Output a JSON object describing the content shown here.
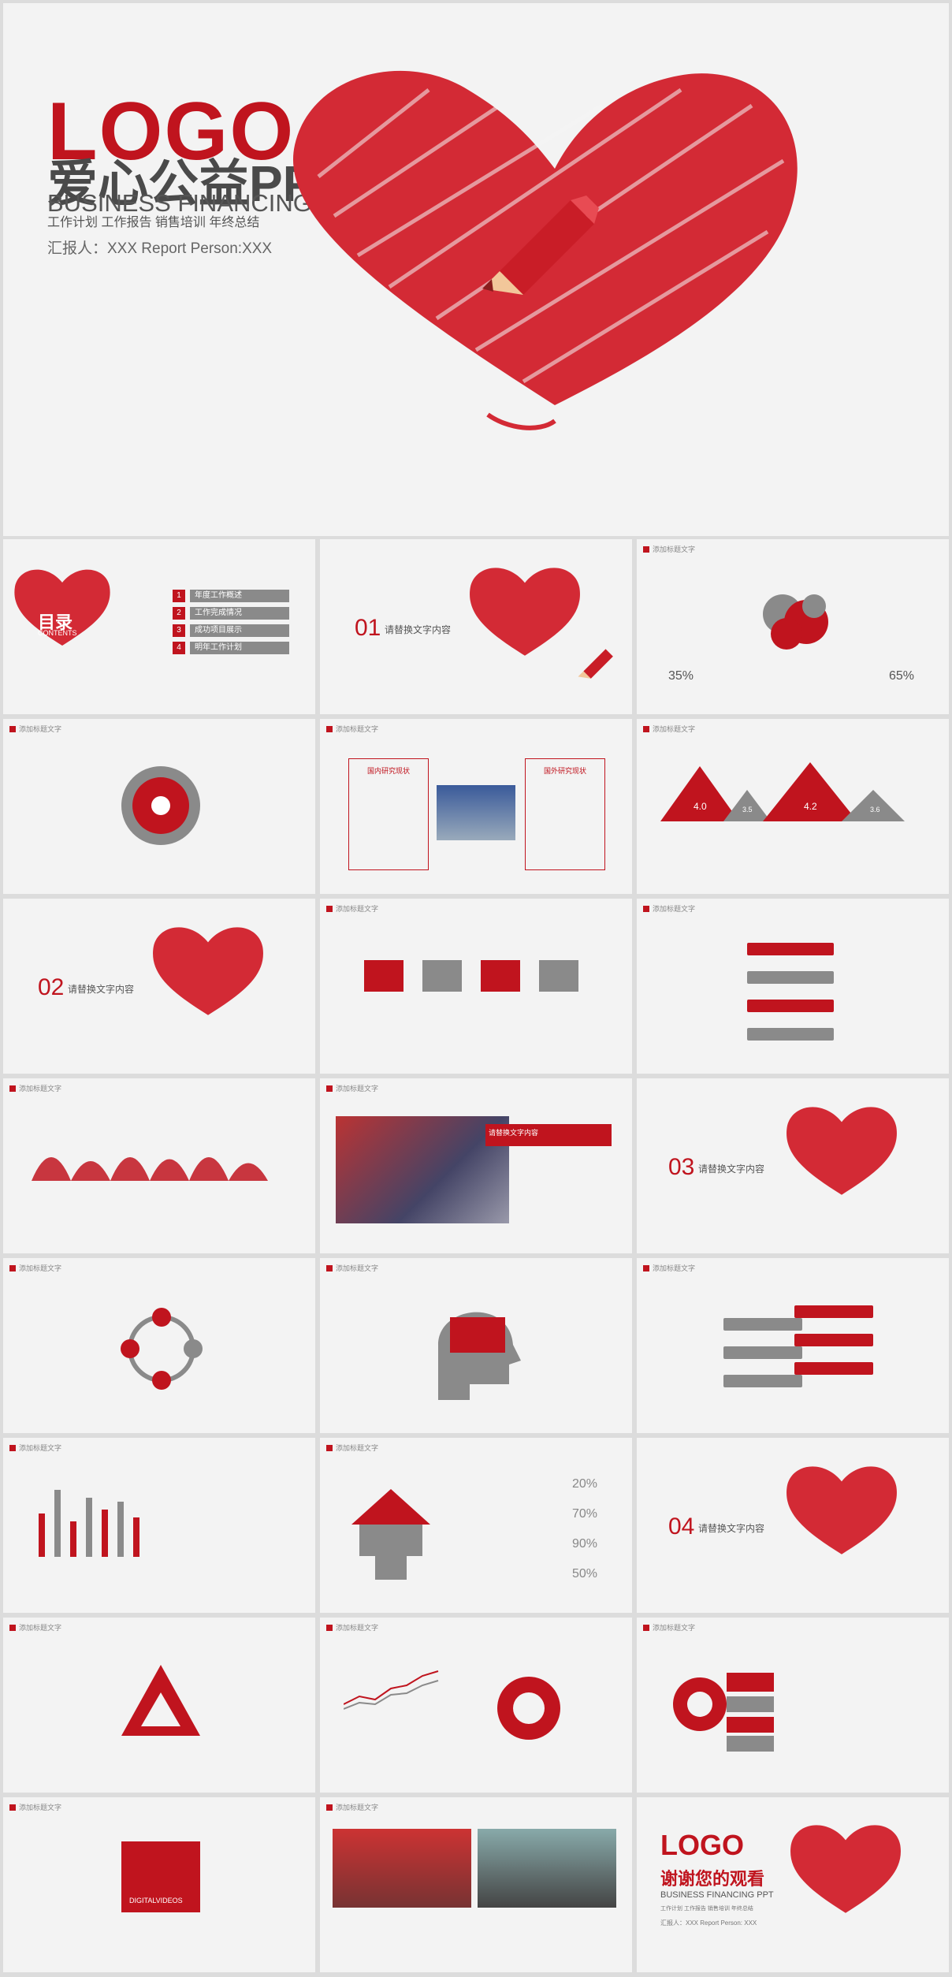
{
  "hero": {
    "logo": "LOGO",
    "title": "爱心公益PPT",
    "subtitle_en": "BUSINESS FINANCING PPT",
    "tags": "工作计划 工作报告 销售培训 年终总结",
    "reporter": "汇报人：XXX  Report Person:XXX"
  },
  "toc": {
    "title": "目录",
    "subtitle": "CONTENTS",
    "items": [
      {
        "num": "1",
        "label": "年度工作概述"
      },
      {
        "num": "2",
        "label": "工作完成情况"
      },
      {
        "num": "3",
        "label": "成功项目展示"
      },
      {
        "num": "4",
        "label": "明年工作计划"
      }
    ]
  },
  "sections": [
    {
      "num": "01",
      "label": "请替换文字内容"
    },
    {
      "num": "02",
      "label": "请替换文字内容"
    },
    {
      "num": "03",
      "label": "请替换文字内容"
    },
    {
      "num": "04",
      "label": "请替换文字内容"
    }
  ],
  "slide_tag": "添加标题文字",
  "percent_left": "35%",
  "percent_right": "65%",
  "box_left_title": "国内研究现状",
  "box_right_title": "国外研究现状",
  "mountain_values": [
    "4.0",
    "3.5",
    "4.2",
    "3.6"
  ],
  "house_percents": [
    "20%",
    "70%",
    "90%",
    "50%"
  ],
  "photo_banner_title": "请替换文字内容",
  "digital_label": "DIGITALVIDEOS",
  "closing": {
    "logo": "LOGO",
    "title": "谢谢您的观看",
    "subtitle_en": "BUSINESS FINANCING PPT",
    "tags": "工作计划 工作报告 销售培训 年终总结",
    "reporter": "汇报人：XXX  Report Person: XXX"
  },
  "colors": {
    "accent": "#c0141e",
    "gray": "#8a8a8a",
    "bg": "#f3f3f3"
  }
}
